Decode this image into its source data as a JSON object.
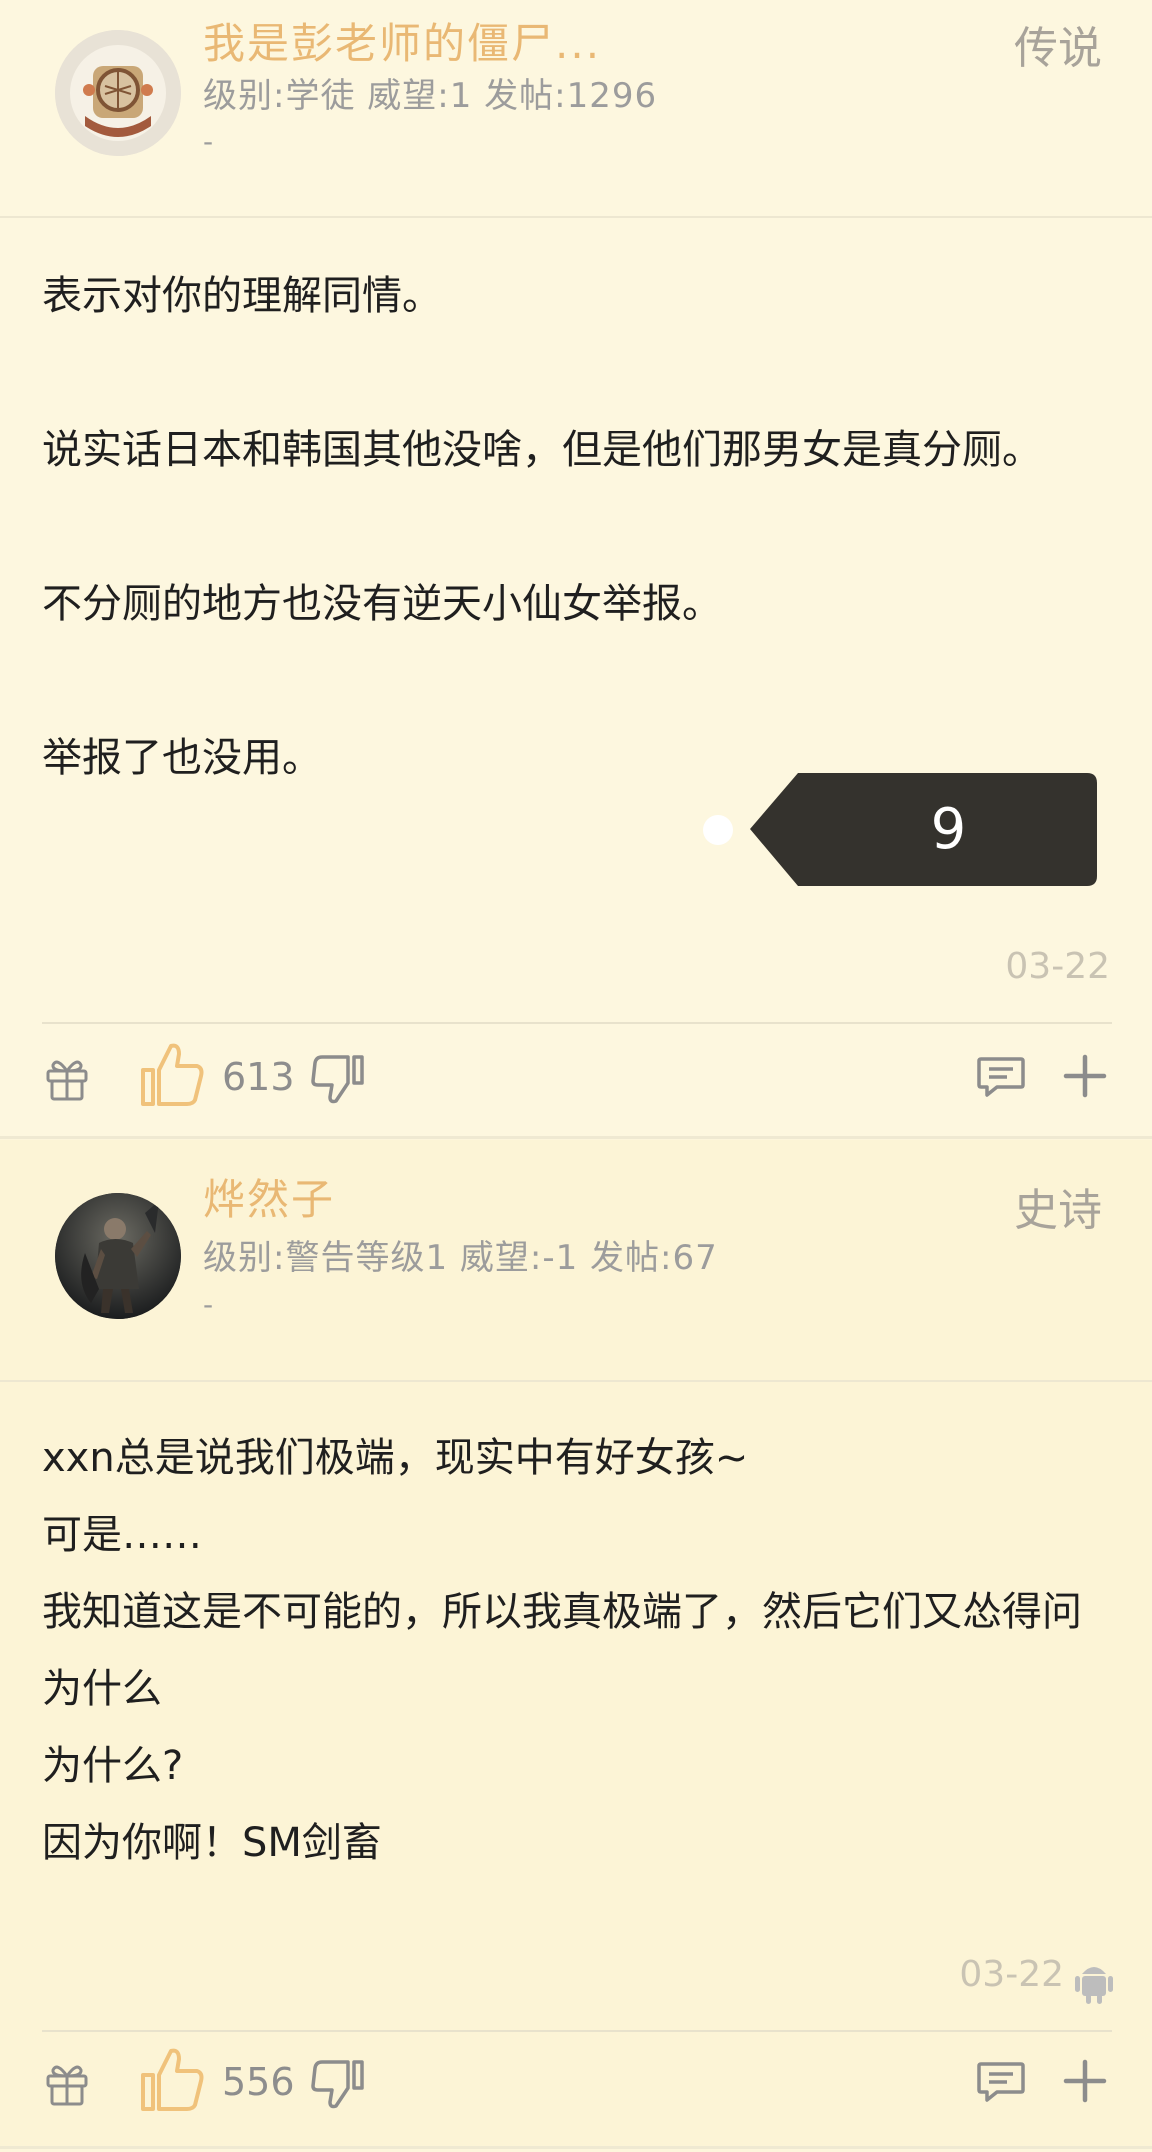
{
  "posts": [
    {
      "username": "我是彭老师的僵尸...",
      "meta": "级别:学徒 威望:1 发帖:1296",
      "dash": "-",
      "rank": "传说",
      "content": [
        "表示对你的理解同情。",
        "",
        "说实话日本和韩国其他没啥，但是他们那男女是真分厕。",
        "",
        "不分厕的地方也没有逆天小仙女举报。",
        "",
        "举报了也没用。"
      ],
      "date": "03-22",
      "likes": "613",
      "icons": {
        "gift": "gift-icon",
        "like": "thumbs-up-icon",
        "dislike": "thumbs-down-icon",
        "reply": "comment-icon",
        "more": "plus-icon"
      }
    },
    {
      "username": "烨然子",
      "meta": "级别:警告等级1 威望:-1 发帖:67",
      "dash": "-",
      "rank": "史诗",
      "content": [
        "xxn总是说我们极端，现实中有好女孩~",
        "可是……",
        "我知道这是不可能的，所以我真极端了，然后它们又怂得问为什么",
        "为什么?",
        "因为你啊！SM剑畜"
      ],
      "date": "03-22",
      "likes": "556",
      "device_icon": "android-icon",
      "icons": {
        "gift": "gift-icon",
        "like": "thumbs-up-icon",
        "dislike": "thumbs-down-icon",
        "reply": "comment-icon",
        "more": "plus-icon"
      }
    }
  ],
  "tooltip": {
    "label": "9"
  },
  "colors": {
    "username": "#e9b874",
    "tooltip_bg": "#34322d",
    "like_icon": "#f0c27b"
  }
}
